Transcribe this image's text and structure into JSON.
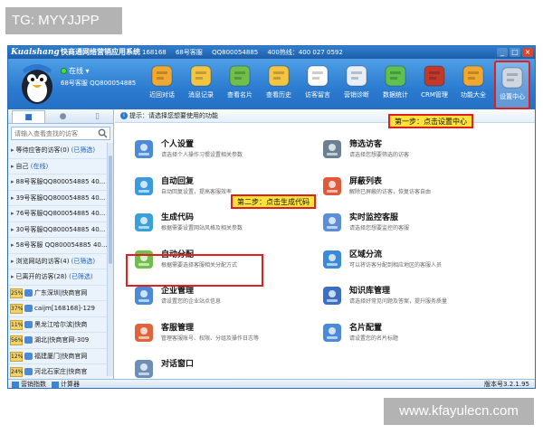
{
  "watermarks": {
    "top": "TG: MYYJJPP",
    "bottom": "www.kfayulecn.com"
  },
  "titlebar": {
    "brand": "Kuaishang",
    "title": "快商通网络营销应用系统",
    "info": [
      "168168",
      "68号客服",
      "QQ800054885",
      "400热线：400 027 0592"
    ],
    "controls": [
      "_",
      "□",
      "×"
    ]
  },
  "user": {
    "status": "在线",
    "id": "68号客服 QQ800054885"
  },
  "toolbar": [
    {
      "label": "近回对话",
      "icon": "back-arrow-icon",
      "color": "#f0a830"
    },
    {
      "label": "消息记录",
      "icon": "message-record-icon",
      "color": "#f4c542"
    },
    {
      "label": "查看名片",
      "icon": "business-card-icon",
      "color": "#6fbf4a"
    },
    {
      "label": "查看历史",
      "icon": "history-icon",
      "color": "#f4c542"
    },
    {
      "label": "访客留言",
      "icon": "visitor-message-icon",
      "color": "#ffffff"
    },
    {
      "label": "营销诊断",
      "icon": "marketing-diagnosis-icon",
      "color": "#e8eef7"
    },
    {
      "label": "数据统计",
      "icon": "data-stats-icon",
      "color": "#5fbf4f"
    },
    {
      "label": "CRM管理",
      "icon": "crm-icon",
      "color": "#c0392b"
    },
    {
      "label": "功能大全",
      "icon": "functions-icon",
      "color": "#f0a830"
    },
    {
      "label": "设置中心",
      "icon": "settings-gear-icon",
      "color": "#d0d7e0"
    }
  ],
  "sidebar": {
    "search_placeholder": "请输入查看查找的访客",
    "rows": [
      {
        "kind": "group",
        "text": "等待应答的访客(0)",
        "link": "(已筛选)"
      },
      {
        "kind": "group",
        "text": "自己",
        "link": "(在线)"
      },
      {
        "kind": "group",
        "text": "88号客服QQ800054885   40..."
      },
      {
        "kind": "group",
        "text": "39号客服QQ800054885   40..."
      },
      {
        "kind": "group",
        "text": "76号客服QQ800054885   40..."
      },
      {
        "kind": "group",
        "text": "30号客服QQ800054885   40..."
      },
      {
        "kind": "group",
        "text": "58号客服 QQ800054885   40..."
      },
      {
        "kind": "group",
        "text": "浏览网站的访客(4)",
        "link": "(已筛选)"
      },
      {
        "kind": "group",
        "text": "已离开的访客(28)",
        "link": "(已筛选)"
      },
      {
        "kind": "visitor",
        "pct": "25%",
        "text": "广东深圳|快商官网"
      },
      {
        "kind": "visitor",
        "pct": "37%",
        "text": "caijm[168168]-129"
      },
      {
        "kind": "visitor",
        "pct": "11%",
        "text": "黑龙江哈尔滨|快商"
      },
      {
        "kind": "visitor",
        "pct": "56%",
        "text": "湖北|快商官网-309"
      },
      {
        "kind": "visitor",
        "pct": "12%",
        "text": "福建厦门|快商官网"
      },
      {
        "kind": "visitor",
        "pct": "24%",
        "text": "河北石家庄|快商官"
      }
    ]
  },
  "main": {
    "hint": "提示：请选择您想要使用的功能",
    "features": [
      {
        "title": "个人设置",
        "desc": "请选择个人操作习惯设置相关参数",
        "icon": "person-settings-icon"
      },
      {
        "title": "筛选访客",
        "desc": "请选择您想要筛选的访客",
        "icon": "filter-visitors-icon"
      },
      {
        "title": "自动回复",
        "desc": "自动回复设置，提高客服效率",
        "icon": "auto-reply-icon"
      },
      {
        "title": "屏蔽列表",
        "desc": "解除已屏蔽的访客，恢复访客自由",
        "icon": "block-list-icon"
      },
      {
        "title": "生成代码",
        "desc": "根据需要设置网站风格及相关参数",
        "icon": "generate-code-icon"
      },
      {
        "title": "实时监控客服",
        "desc": "请选择您想要监控的客服",
        "icon": "monitor-icon"
      },
      {
        "title": "自动分配",
        "desc": "根据需要选择客服相关分配方式",
        "icon": "auto-assign-icon"
      },
      {
        "title": "区域分流",
        "desc": "可以将访客分配到相应地区的客服人员",
        "icon": "region-route-icon"
      },
      {
        "title": "企业管理",
        "desc": "请设置您的企业站点信息",
        "icon": "company-icon"
      },
      {
        "title": "知识库管理",
        "desc": "请选择好常见问题及答案，提升服务质量",
        "icon": "knowledge-base-icon"
      },
      {
        "title": "客服管理",
        "desc": "管理客服账号、权限、分组及操作日志等",
        "icon": "staff-manage-icon"
      },
      {
        "title": "名片配置",
        "desc": "请设置您的名片标题",
        "icon": "card-config-icon"
      },
      {
        "title": "对话窗口",
        "desc": "",
        "icon": "chat-window-icon"
      }
    ]
  },
  "callouts": {
    "step1": "第一步：点击设置中心",
    "step2": "第二步：点击生成代码"
  },
  "statusbar": {
    "left1": "营销指数",
    "left2": "计算器",
    "version": "版本号3.2.1.95"
  }
}
